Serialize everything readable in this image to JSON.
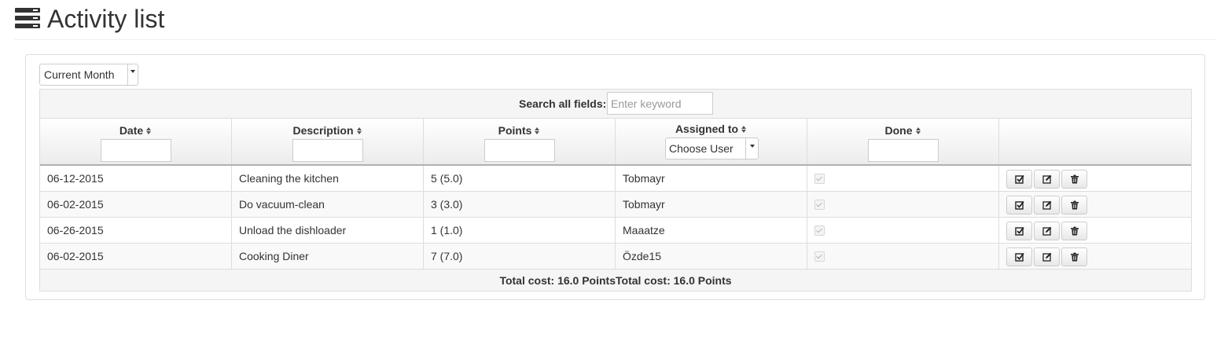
{
  "header": {
    "title": "Activity list",
    "icon": "server-list-icon"
  },
  "filter": {
    "period": "Current Month"
  },
  "search": {
    "label": "Search all fields:",
    "placeholder": "Enter keyword"
  },
  "columns": [
    {
      "label": "Date"
    },
    {
      "label": "Description"
    },
    {
      "label": "Points"
    },
    {
      "label": "Assigned to",
      "filter_value": "Choose User"
    },
    {
      "label": "Done"
    },
    {
      "label": ""
    }
  ],
  "rows": [
    {
      "date": "06-12-2015",
      "description": "Cleaning the kitchen",
      "points": "5 (5.0)",
      "assigned": "Tobmayr",
      "done": true
    },
    {
      "date": "06-02-2015",
      "description": "Do vacuum-clean",
      "points": "3 (3.0)",
      "assigned": "Tobmayr",
      "done": true
    },
    {
      "date": "06-26-2015",
      "description": "Unload the dishloader",
      "points": "1 (1.0)",
      "assigned": "Maaatze",
      "done": true
    },
    {
      "date": "06-02-2015",
      "description": "Cooking Diner",
      "points": "7 (7.0)",
      "assigned": "Özde15",
      "done": true
    }
  ],
  "row_actions": [
    "check-square-icon",
    "edit-icon",
    "trash-icon"
  ],
  "footer": {
    "total_text": "Total cost: 16.0 PointsTotal cost: 16.0 Points"
  }
}
